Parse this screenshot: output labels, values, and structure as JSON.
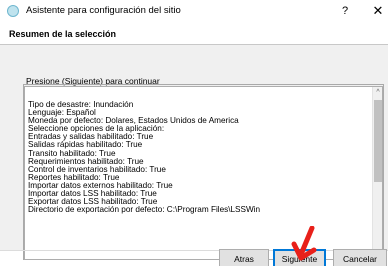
{
  "window": {
    "title": "Asistente para configuración del sitio",
    "help_label": "?",
    "close_label": "✕",
    "icon": "app-icon"
  },
  "header": {
    "title": "Resumen de la selección"
  },
  "body": {
    "instruction": "Presione (Siguiente) para continuar",
    "summary_lines": [
      "Tipo de desastre: Inundación",
      "Lenguaje: Español",
      "Moneda por defecto: Dolares, Estados Unidos de America",
      "Seleccione opciones de la aplicación:",
      "Entradas y salidas habilitado: True",
      "Salidas rápidas habilitado: True",
      "Transito habilitado: True",
      "Requerimientos habilitado: True",
      "Control de inventarios habilitado: True",
      "Reportes habilitado: True",
      "Importar datos externos habilitado: True",
      "Importar datos LSS habilitado: True",
      "Exportar datos LSS habilitado: True",
      " Directorio de exportación por defecto: C:\\Program Files\\LSSWin"
    ]
  },
  "scrollbar": {
    "up_icon": "chevron-up-icon",
    "down_icon": "chevron-down-icon",
    "up_glyph": "^",
    "down_glyph": "v"
  },
  "footer": {
    "back_label": "Atras",
    "next_label": "Siguiente",
    "cancel_label": "Cancelar"
  },
  "annotation": {
    "arrow_color": "#e8201a",
    "icon": "red-arrow-icon"
  }
}
